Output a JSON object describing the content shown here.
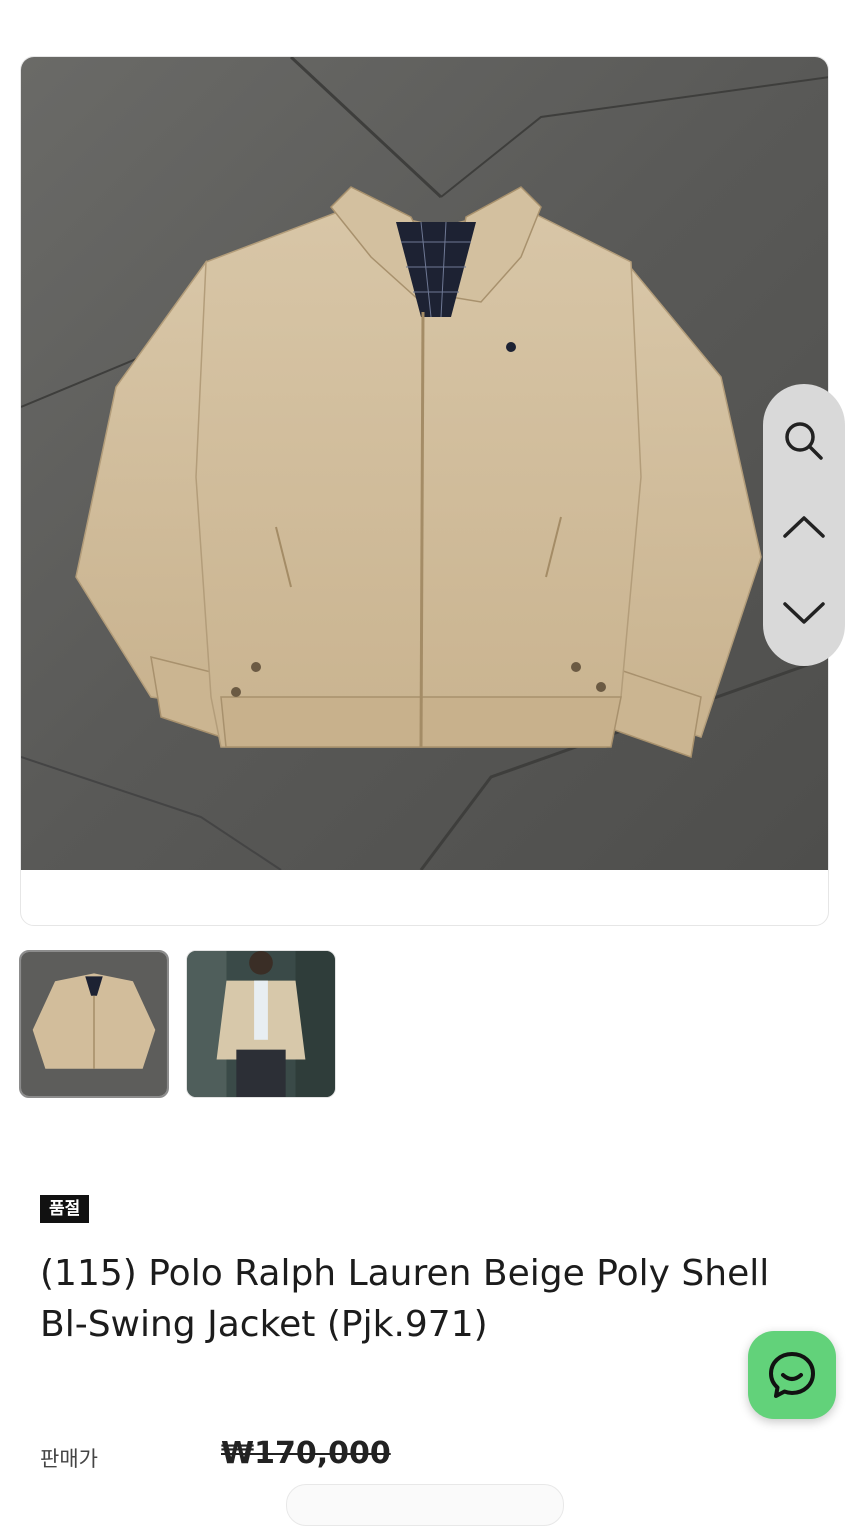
{
  "product": {
    "badge": "품절",
    "title": "(115) Polo Ralph Lauren Beige Poly Shell Bl-Swing Jacket (Pjk.971)",
    "price_label": "판매가",
    "price_original": "₩170,000",
    "main_image_alt": "Beige Polo Ralph Lauren swing jacket laid flat on grey stone floor",
    "thumbnails": [
      {
        "alt": "Jacket laid flat thumbnail",
        "selected": true
      },
      {
        "alt": "Person wearing jacket thumbnail",
        "selected": false
      }
    ]
  },
  "floating_nav": {
    "search_icon": "search-icon",
    "up_icon": "chevron-up-icon",
    "down_icon": "chevron-down-icon"
  },
  "chat": {
    "icon": "chat-bubble-icon"
  },
  "colors": {
    "accent_green": "#62d27a",
    "badge_bg": "#111111",
    "jacket_beige": "#d2bd9b",
    "floor_grey": "#5a5a58"
  }
}
